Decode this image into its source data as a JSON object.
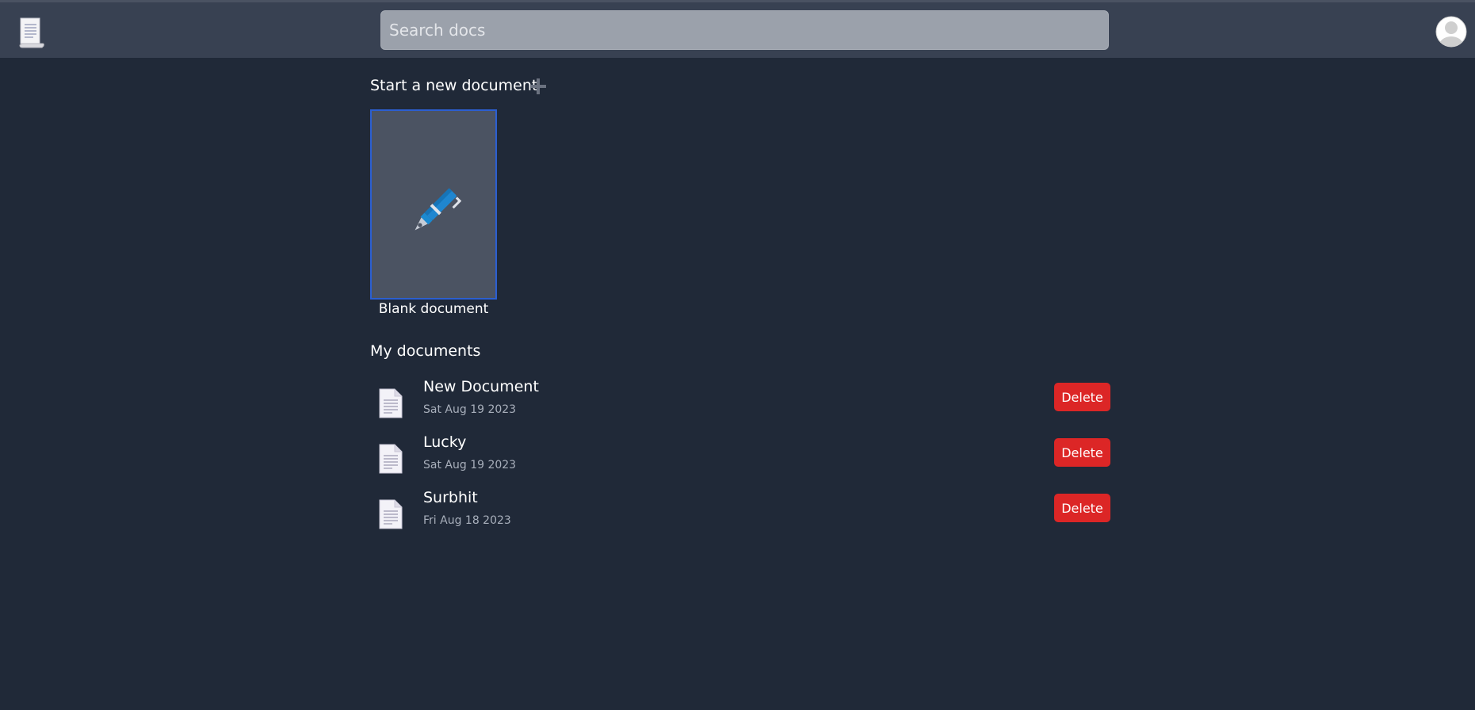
{
  "header": {
    "logo_icon": "document-scroll-icon",
    "search": {
      "placeholder": "Search docs",
      "value": ""
    },
    "avatar_icon": "user-avatar-icon"
  },
  "new_document": {
    "title": "Start a new document",
    "add_icon": "plus-icon",
    "templates": [
      {
        "label": "Blank document",
        "icon": "fountain-pen-icon",
        "accent": "#2c5fd1"
      }
    ]
  },
  "my_documents": {
    "title": "My documents",
    "delete_label": "Delete",
    "delete_color": "#dc2626",
    "items": [
      {
        "name": "New Document",
        "date": "Sat Aug 19 2023",
        "icon": "file-text-icon"
      },
      {
        "name": "Lucky",
        "date": "Sat Aug 19 2023",
        "icon": "file-text-icon"
      },
      {
        "name": "Surbhit",
        "date": "Fri Aug 18 2023",
        "icon": "file-text-icon"
      }
    ]
  },
  "colors": {
    "background": "#202938",
    "topbar": "#384152",
    "card": "#4b5362"
  }
}
